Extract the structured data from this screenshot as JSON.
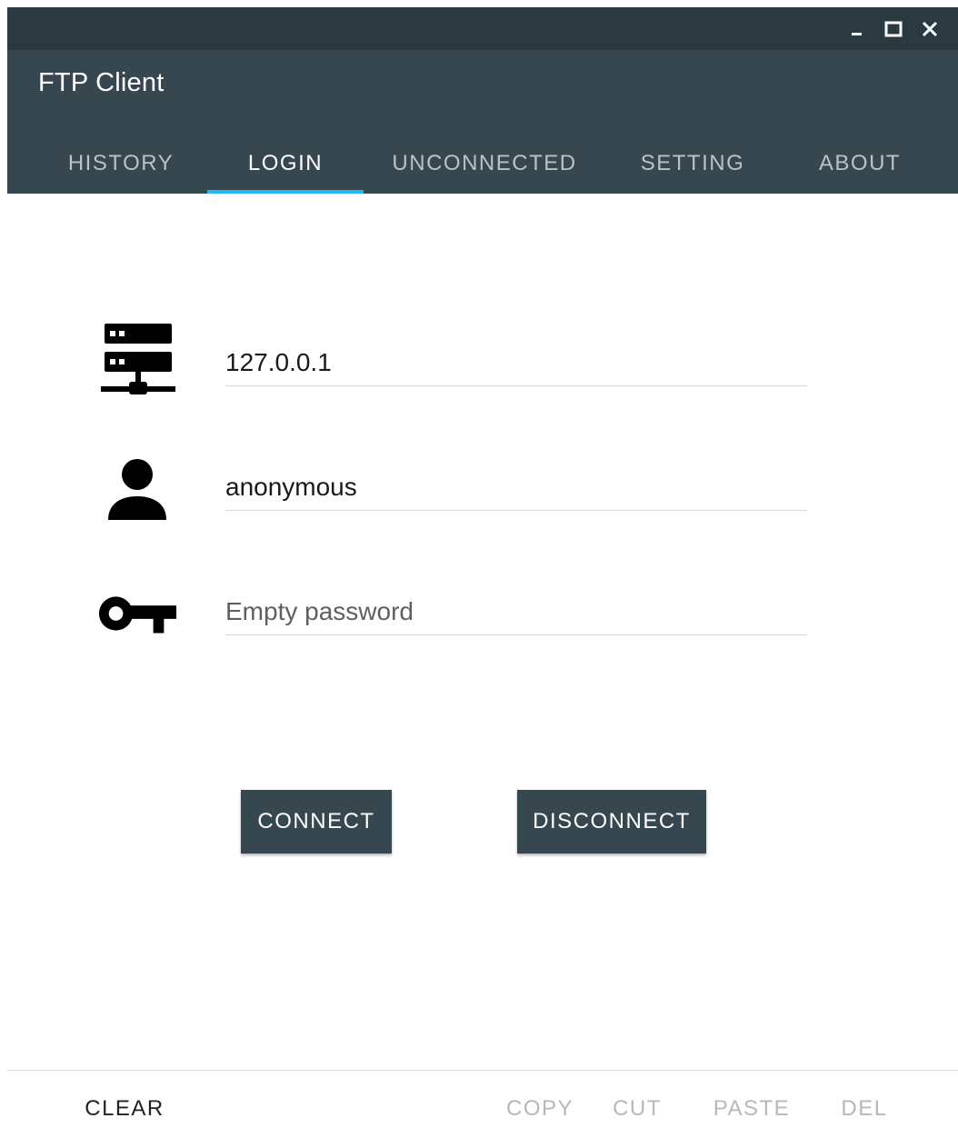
{
  "window": {
    "title": "FTP Client",
    "controls": {
      "minimize_icon": "minimize-icon",
      "maximize_icon": "maximize-icon",
      "close_icon": "close-icon"
    }
  },
  "tabs": [
    {
      "label": "HISTORY",
      "active": false
    },
    {
      "label": "LOGIN",
      "active": true
    },
    {
      "label": "UNCONNECTED",
      "active": false
    },
    {
      "label": "SETTING",
      "active": false
    },
    {
      "label": "ABOUT",
      "active": false
    }
  ],
  "login": {
    "host": {
      "value": "127.0.0.1",
      "placeholder": "",
      "icon": "server-icon"
    },
    "username": {
      "value": "anonymous",
      "placeholder": "",
      "icon": "person-icon"
    },
    "password": {
      "value": "",
      "placeholder": "Empty password",
      "icon": "key-icon"
    }
  },
  "actions": {
    "connect_label": "CONNECT",
    "disconnect_label": "DISCONNECT"
  },
  "bottom_bar": {
    "clear_label": "CLEAR",
    "copy_label": "COPY",
    "cut_label": "CUT",
    "paste_label": "PASTE",
    "del_label": "DEL"
  },
  "colors": {
    "titlebar": "#2b3a41",
    "appbar": "#37474f",
    "tab_indicator": "#29b6f6",
    "button": "#37474f"
  }
}
